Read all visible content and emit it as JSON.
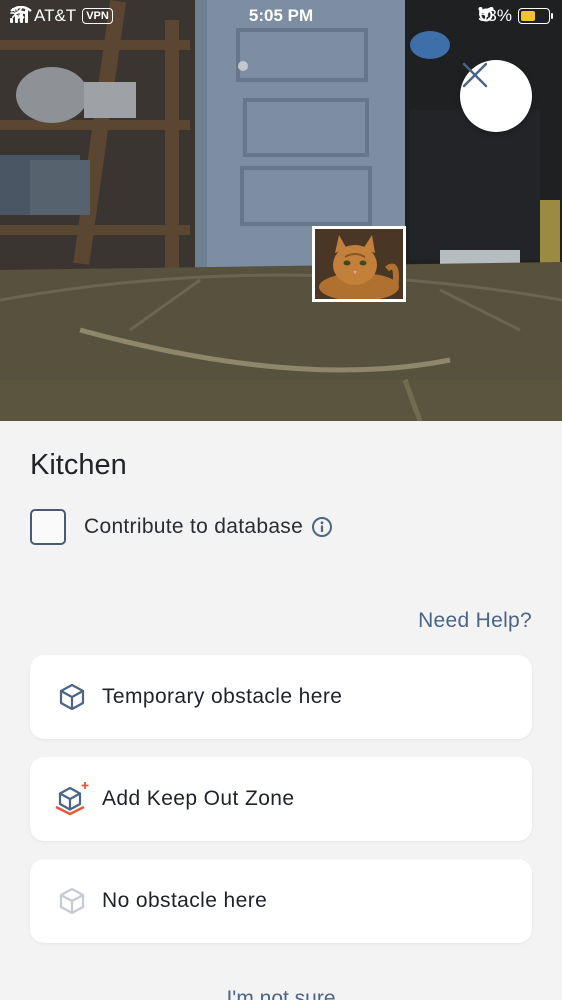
{
  "status_bar": {
    "carrier": "AT&T",
    "vpn": "VPN",
    "time": "5:05 PM",
    "battery_percent": "53%",
    "battery_level": 0.53,
    "icons": [
      "signal-icon",
      "wifi-icon",
      "vpn-icon",
      "loading-icon",
      "location-arrow-icon",
      "alarm-icon",
      "battery-icon"
    ]
  },
  "camera": {
    "close_icon": "close-icon",
    "detection": "cat-thumbnail"
  },
  "sheet": {
    "title": "Kitchen",
    "contribute_label": "Contribute to database",
    "contribute_checked": false,
    "help_link": "Need Help?",
    "options": [
      {
        "label": "Temporary obstacle here",
        "icon": "cube-icon"
      },
      {
        "label": "Add Keep Out Zone",
        "icon": "cube-keep-out-icon"
      },
      {
        "label": "No obstacle here",
        "icon": "cube-faded-icon"
      }
    ],
    "footer_link": "I'm not sure"
  },
  "colors": {
    "accent": "#4b6584",
    "keep_out": "#e25a3c",
    "battery": "#f4c430",
    "sheet_bg": "#f3f3f3",
    "card_bg": "#ffffff"
  }
}
